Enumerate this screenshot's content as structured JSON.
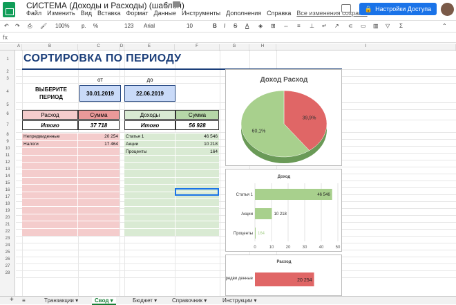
{
  "app": {
    "title": "СИСТЕМА (Доходы и Расходы) (шаблон)",
    "share_label": "Настройки Доступа",
    "saved_status": "Все изменения сохран..."
  },
  "menus": [
    "Файл",
    "Изменить",
    "Вид",
    "Вставка",
    "Формат",
    "Данные",
    "Инструменты",
    "Дополнения",
    "Справка"
  ],
  "toolbar": {
    "zoom": "100%",
    "currency": "р.",
    "percent": "%",
    ".0": ".0",
    ".00": ".00",
    "format": "123",
    "font": "Arial",
    "size": "10",
    "bold": "B",
    "italic": "I",
    "strike": "S",
    "color": "A"
  },
  "columns": [
    "A",
    "B",
    "C",
    "D",
    "E",
    "F",
    "G",
    "H",
    "I"
  ],
  "rows": [
    "1",
    "2",
    "3",
    "4",
    "5",
    "6",
    "7",
    "8",
    "9",
    "10",
    "11",
    "12",
    "13",
    "14",
    "15",
    "16",
    "17",
    "18",
    "19",
    "20",
    "21",
    "22",
    "23",
    "24",
    "25",
    "26",
    "27",
    "28"
  ],
  "sheet": {
    "heading": "СОРТИРОВКА ПО ПЕРИОДУ",
    "period_label_1": "ВЫБЕРИТЕ",
    "period_label_2": "ПЕРИОД",
    "from_label": "от",
    "to_label": "до",
    "from_date": "30.01.2019",
    "to_date": "22.06.2019",
    "expense_header": "Расход",
    "expense_sum_header": "Сумма",
    "income_header": "Доходы",
    "income_sum_header": "Сумма",
    "total_label": "Итого",
    "expense_total": "37 718",
    "income_total": "56 928",
    "expenses": [
      {
        "name": "Непредвиденные",
        "value": "20 254"
      },
      {
        "name": "Налоги",
        "value": "17 464"
      }
    ],
    "incomes": [
      {
        "name": "Статья 1",
        "value": "46 546"
      },
      {
        "name": "Акции",
        "value": "10 218"
      },
      {
        "name": "Проценты",
        "value": "164"
      }
    ]
  },
  "colors": {
    "expense": "#f4cccc",
    "expense_header": "#ea9999",
    "income": "#d9ead3",
    "income_header": "#b6d7a8",
    "pie_green": "#a8d08d",
    "pie_red": "#e06666",
    "bar_green": "#a8d08d",
    "bar_red": "#e06666"
  },
  "chart_data": [
    {
      "type": "pie",
      "title": "Доход Расход",
      "labels": [
        "Доход",
        "Расход"
      ],
      "values": [
        60.1,
        39.9
      ],
      "data_labels": [
        "60,1%",
        "39,9%"
      ]
    },
    {
      "type": "bar",
      "orientation": "horizontal",
      "title": "Доход",
      "categories": [
        "Статья 1",
        "Акции",
        "Проценты"
      ],
      "values": [
        46546,
        10218,
        164
      ],
      "data_labels": [
        "46 546",
        "10 218",
        "164"
      ],
      "xticks": [
        "0",
        "10",
        "20",
        "30",
        "40",
        "50"
      ]
    },
    {
      "type": "bar",
      "orientation": "horizontal",
      "title": "Расход",
      "categories": [
        "Непредви денные"
      ],
      "values": [
        20254
      ],
      "data_labels": [
        "20 254"
      ]
    }
  ],
  "tabs": {
    "add": "+",
    "list": "≡",
    "items": [
      "Транзакции",
      "Свод",
      "Бюджет",
      "Справочник",
      "Инструкции"
    ]
  }
}
